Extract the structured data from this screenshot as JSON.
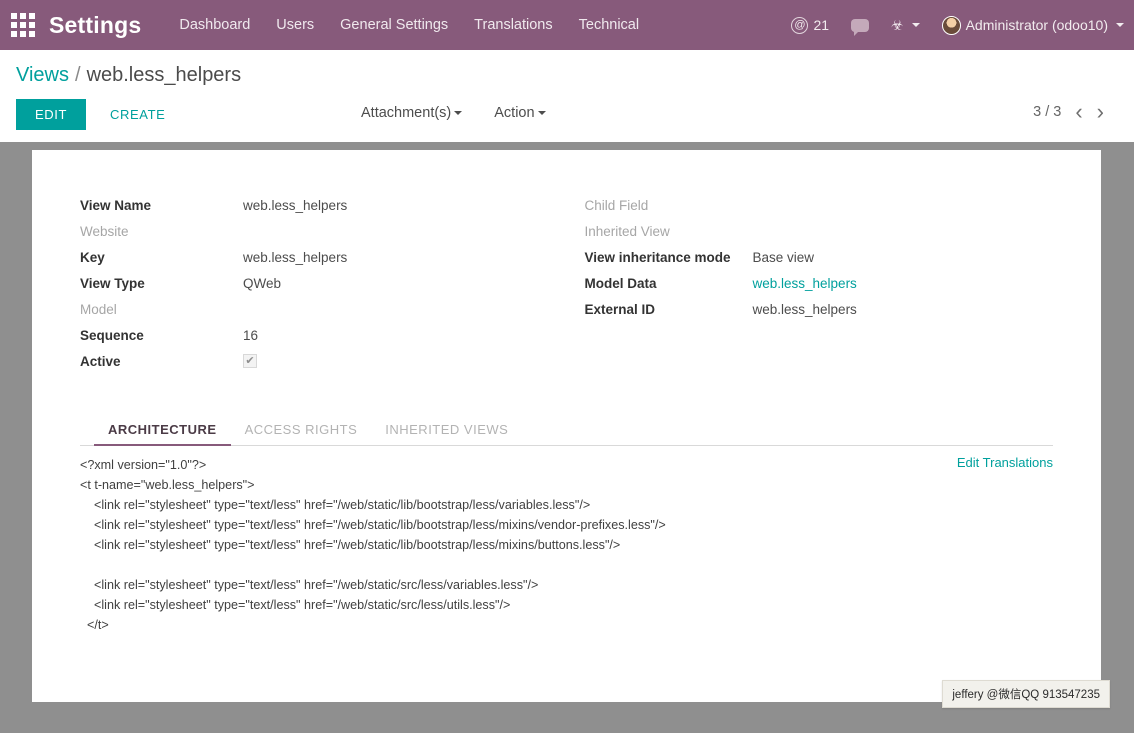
{
  "navbar": {
    "apps_icon": "apps-grid-icon",
    "brand": "Settings",
    "menu": [
      {
        "label": "Dashboard"
      },
      {
        "label": "Users"
      },
      {
        "label": "General Settings"
      },
      {
        "label": "Translations"
      },
      {
        "label": "Technical"
      }
    ],
    "mention_icon": "@",
    "mention_count": "21",
    "chat_icon": "chat-bubble-icon",
    "debug_icon": "☣",
    "user_name": "Administrator (odoo10)"
  },
  "breadcrumb": {
    "parent": "Views",
    "separator": "/",
    "current": "web.less_helpers"
  },
  "toolbar": {
    "edit_label": "EDIT",
    "create_label": "CREATE",
    "attachments_label": "Attachment(s)",
    "action_label": "Action",
    "pager_count": "3 / 3",
    "prev_icon": "‹",
    "next_icon": "›"
  },
  "form": {
    "left": [
      {
        "label": "View Name",
        "value": "web.less_helpers",
        "muted": false,
        "type": "text"
      },
      {
        "label": "Website",
        "value": "",
        "muted": true,
        "type": "text"
      },
      {
        "label": "Key",
        "value": "web.less_helpers",
        "muted": false,
        "type": "text"
      },
      {
        "label": "View Type",
        "value": "QWeb",
        "muted": false,
        "type": "text"
      },
      {
        "label": "Model",
        "value": "",
        "muted": true,
        "type": "text"
      },
      {
        "label": "Sequence",
        "value": "16",
        "muted": false,
        "type": "text"
      },
      {
        "label": "Active",
        "value": "✔",
        "muted": false,
        "type": "checkbox"
      }
    ],
    "right": [
      {
        "label": "Child Field",
        "value": "",
        "muted": true,
        "type": "text"
      },
      {
        "label": "Inherited View",
        "value": "",
        "muted": true,
        "type": "text"
      },
      {
        "label": "View inheritance mode",
        "value": "Base view",
        "muted": false,
        "type": "text"
      },
      {
        "label": "Model Data",
        "value": "web.less_helpers",
        "muted": false,
        "type": "link"
      },
      {
        "label": "External ID",
        "value": "web.less_helpers",
        "muted": false,
        "type": "text"
      }
    ]
  },
  "notebook": {
    "tabs": [
      {
        "label": "ARCHITECTURE",
        "active": true
      },
      {
        "label": "ACCESS RIGHTS",
        "active": false
      },
      {
        "label": "INHERITED VIEWS",
        "active": false
      }
    ],
    "edit_translations_label": "Edit Translations",
    "architecture_code": "<?xml version=\"1.0\"?>\n<t t-name=\"web.less_helpers\">\n    <link rel=\"stylesheet\" type=\"text/less\" href=\"/web/static/lib/bootstrap/less/variables.less\"/>\n    <link rel=\"stylesheet\" type=\"text/less\" href=\"/web/static/lib/bootstrap/less/mixins/vendor-prefixes.less\"/>\n    <link rel=\"stylesheet\" type=\"text/less\" href=\"/web/static/lib/bootstrap/less/mixins/buttons.less\"/>\n\n    <link rel=\"stylesheet\" type=\"text/less\" href=\"/web/static/src/less/variables.less\"/>\n    <link rel=\"stylesheet\" type=\"text/less\" href=\"/web/static/src/less/utils.less\"/>\n  </t>"
  },
  "watermark": {
    "text": "jeffery @微信QQ 913547235"
  },
  "colors": {
    "brand_purple": "#875A7B",
    "accent_teal": "#00A09D",
    "page_grey": "#8f8f8f"
  }
}
